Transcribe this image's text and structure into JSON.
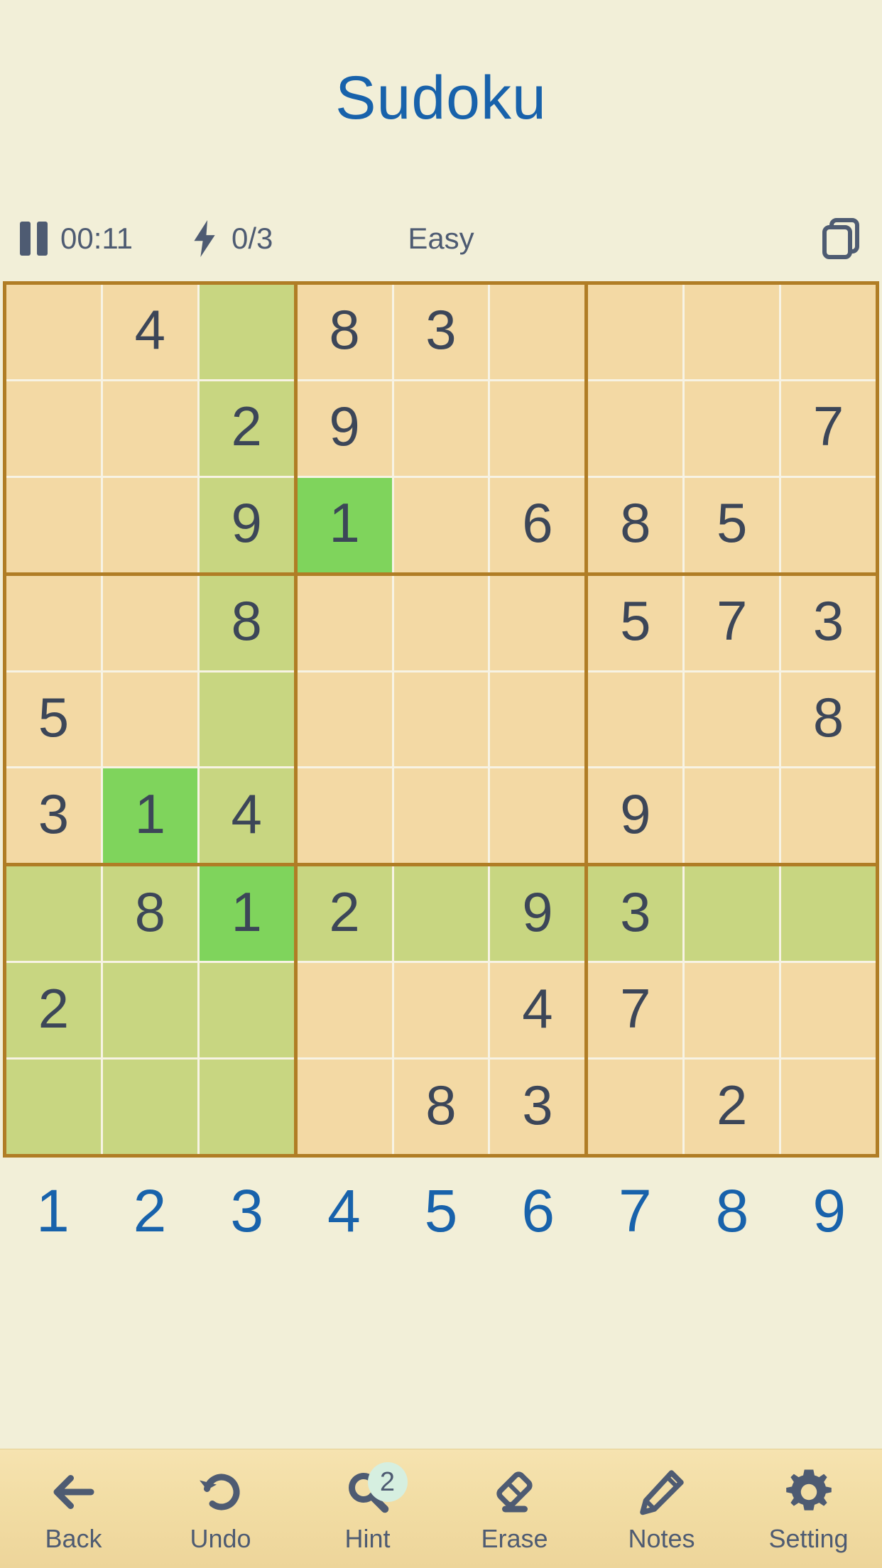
{
  "header": {
    "title": "Sudoku"
  },
  "status": {
    "pause_icon": "pause-icon",
    "timer": "00:11",
    "bolt_icon": "lightning-bolt-icon",
    "mistakes": "0/3",
    "difficulty": "Easy",
    "copy_icon": "copy-icon"
  },
  "board": {
    "accent_border": "#b07d25",
    "cell_bg": "#f3d9a4",
    "highlight_bg": "#c8d681",
    "selected_bg": "#7fd45c",
    "digit_color": "#3c4658",
    "selected": {
      "row": 2,
      "col": 3
    },
    "rows": [
      [
        "",
        "4",
        "",
        "8",
        "3",
        "",
        "",
        "",
        ""
      ],
      [
        "",
        "",
        "2",
        "9",
        "",
        "",
        "",
        "",
        "7"
      ],
      [
        "",
        "",
        "9",
        "1",
        "",
        "6",
        "8",
        "5",
        ""
      ],
      [
        "",
        "",
        "8",
        "",
        "",
        "",
        "5",
        "7",
        "3"
      ],
      [
        "5",
        "",
        "",
        "",
        "",
        "",
        "",
        "",
        "8"
      ],
      [
        "3",
        "1",
        "4",
        "",
        "",
        "",
        "9",
        "",
        ""
      ],
      [
        "",
        "8",
        "1",
        "2",
        "",
        "9",
        "3",
        "",
        ""
      ],
      [
        "2",
        "",
        "",
        "",
        "",
        "4",
        "7",
        "",
        ""
      ],
      [
        "",
        "",
        "",
        "",
        "8",
        "3",
        "",
        "2",
        ""
      ]
    ],
    "highlight": [
      [
        false,
        false,
        true,
        false,
        false,
        false,
        false,
        false,
        false
      ],
      [
        false,
        false,
        true,
        false,
        false,
        false,
        false,
        false,
        false
      ],
      [
        false,
        false,
        true,
        false,
        false,
        false,
        false,
        false,
        false
      ],
      [
        false,
        false,
        true,
        false,
        false,
        false,
        false,
        false,
        false
      ],
      [
        false,
        false,
        true,
        false,
        false,
        false,
        false,
        false,
        false
      ],
      [
        false,
        true,
        true,
        false,
        false,
        false,
        false,
        false,
        false
      ],
      [
        true,
        true,
        true,
        true,
        true,
        true,
        true,
        true,
        true
      ],
      [
        true,
        true,
        true,
        false,
        false,
        false,
        false,
        false,
        false
      ],
      [
        true,
        true,
        true,
        false,
        false,
        false,
        false,
        false,
        false
      ]
    ],
    "bright": [
      [
        false,
        false,
        false,
        false,
        false,
        false,
        false,
        false,
        false
      ],
      [
        false,
        false,
        false,
        false,
        false,
        false,
        false,
        false,
        false
      ],
      [
        false,
        false,
        false,
        true,
        false,
        false,
        false,
        false,
        false
      ],
      [
        false,
        false,
        false,
        false,
        false,
        false,
        false,
        false,
        false
      ],
      [
        false,
        false,
        false,
        false,
        false,
        false,
        false,
        false,
        false
      ],
      [
        false,
        true,
        false,
        false,
        false,
        false,
        false,
        false,
        false
      ],
      [
        false,
        false,
        true,
        false,
        false,
        false,
        false,
        false,
        false
      ],
      [
        false,
        false,
        false,
        false,
        false,
        false,
        false,
        false,
        false
      ],
      [
        false,
        false,
        false,
        false,
        false,
        false,
        false,
        false,
        false
      ]
    ]
  },
  "numpad": {
    "color": "#1862ab",
    "keys": [
      "1",
      "2",
      "3",
      "4",
      "5",
      "6",
      "7",
      "8",
      "9"
    ]
  },
  "toolbar": {
    "items": [
      {
        "label": "Back",
        "icon": "back-arrow-icon",
        "badge": ""
      },
      {
        "label": "Undo",
        "icon": "undo-icon",
        "badge": ""
      },
      {
        "label": "Hint",
        "icon": "magnifier-icon",
        "badge": "2"
      },
      {
        "label": "Erase",
        "icon": "eraser-icon",
        "badge": ""
      },
      {
        "label": "Notes",
        "icon": "pencil-icon",
        "badge": ""
      },
      {
        "label": "Setting",
        "icon": "gear-icon",
        "badge": ""
      }
    ]
  }
}
